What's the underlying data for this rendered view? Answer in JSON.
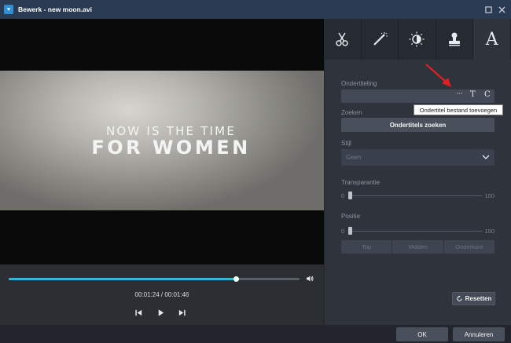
{
  "window": {
    "title": "Bewerk - new moon.avi"
  },
  "video": {
    "caption_line1": "NOW IS THE TIME",
    "caption_line2": "FOR WOMEN"
  },
  "player": {
    "progress": 0.78,
    "timecode": "00:01:24 / 00:01:46"
  },
  "tabs": [
    {
      "icon": "scissors-icon"
    },
    {
      "icon": "magic-wand-icon"
    },
    {
      "icon": "brightness-icon"
    },
    {
      "icon": "stamp-icon"
    },
    {
      "icon": "text-icon",
      "label": "A",
      "active": true
    }
  ],
  "subtitle": {
    "label": "Ondertiteling",
    "more_icon_label": "···",
    "text_icon_label": "T",
    "font_icon_label": "C",
    "tooltip": "Ondertitel bestand toevoegen"
  },
  "search": {
    "label": "Zoeken",
    "button_label": "Ondertitels zoeken"
  },
  "style": {
    "label": "Stijl",
    "selected": "Geen"
  },
  "transparency": {
    "label": "Transparantie",
    "min": "0",
    "max": "100",
    "value": 0
  },
  "position": {
    "label": "Positie",
    "min": "0",
    "max": "100",
    "value": 0,
    "options": [
      "Top",
      "Midden",
      "Onderkant"
    ]
  },
  "reset_label": "Resetten",
  "footer": {
    "ok_label": "OK",
    "cancel_label": "Annuleren"
  },
  "colors": {
    "accent": "#34b6d4",
    "arrow": "#e02020"
  }
}
